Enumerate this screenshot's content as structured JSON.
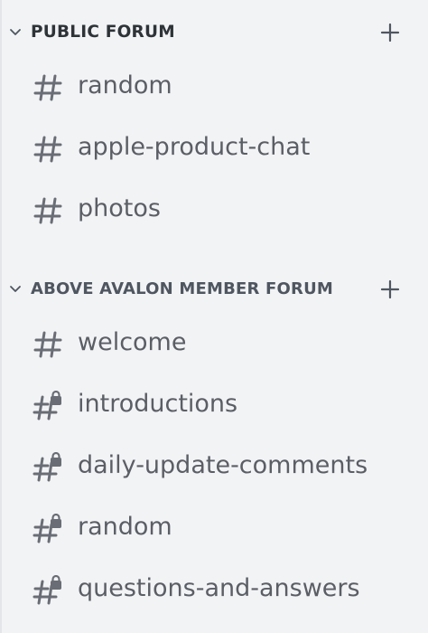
{
  "categories": [
    {
      "label": "PUBLIC FORUM",
      "channels": [
        {
          "name": "random",
          "icon": "hash-icon"
        },
        {
          "name": "apple-product-chat",
          "icon": "hash-icon"
        },
        {
          "name": "photos",
          "icon": "hash-icon"
        }
      ]
    },
    {
      "label": "ABOVE AVALON MEMBER FORUM",
      "channels": [
        {
          "name": "welcome",
          "icon": "hash-icon"
        },
        {
          "name": "introductions",
          "icon": "hash-lock-icon"
        },
        {
          "name": "daily-update-comments",
          "icon": "hash-lock-icon"
        },
        {
          "name": "random",
          "icon": "hash-lock-icon"
        },
        {
          "name": "questions-and-answers",
          "icon": "hash-lock-icon"
        }
      ]
    }
  ],
  "colors": {
    "background": "#f2f3f5",
    "category_text": "#2e3338",
    "channel_text": "#5c5e66",
    "icon": "#6a6d75"
  }
}
